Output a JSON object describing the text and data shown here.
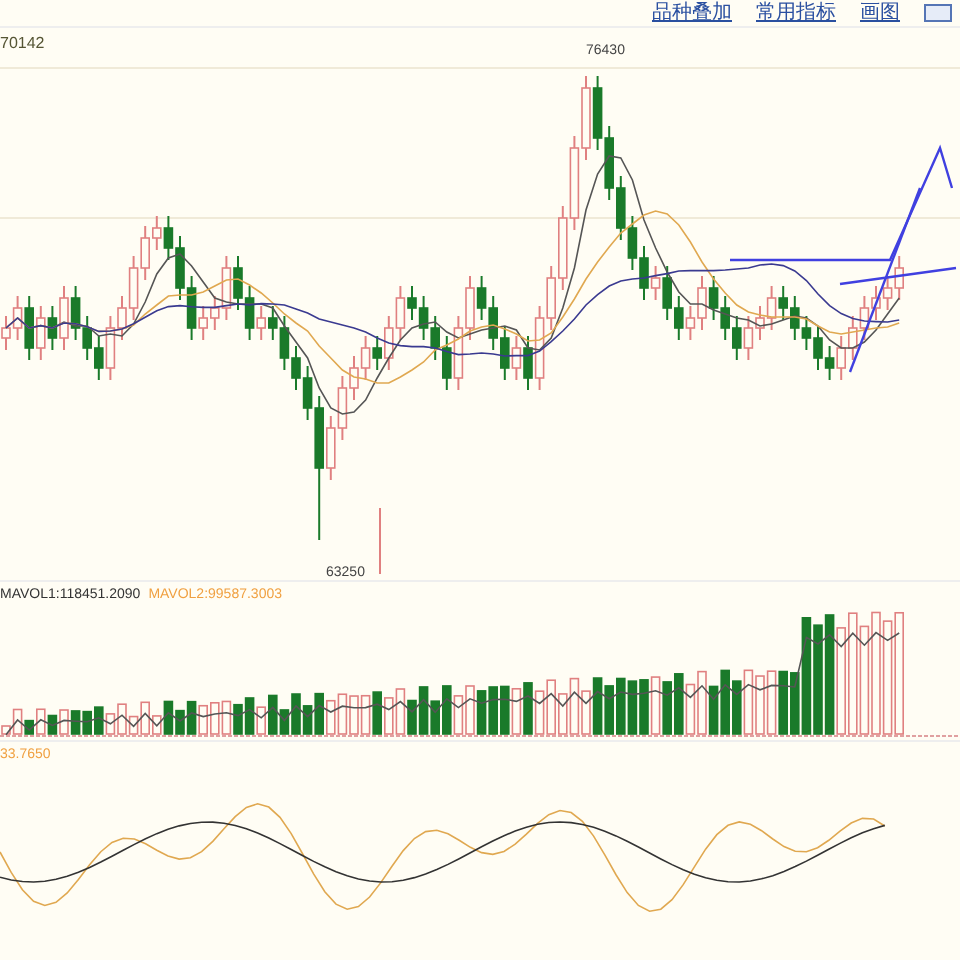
{
  "toolbar": {
    "links": [
      "品种叠加",
      "常用指标",
      "画图"
    ]
  },
  "price_panel": {
    "indicator_value": "70142",
    "high_label": "76430",
    "low_label": "63250"
  },
  "volume_panel": {
    "legend": [
      {
        "text": "MAVOL1:118451.2090",
        "color": "#333333"
      },
      {
        "text": "MAVOL2:99587.3003",
        "color": "#f0a040"
      }
    ]
  },
  "oscillator_panel": {
    "legend": "33.7650"
  }
}
